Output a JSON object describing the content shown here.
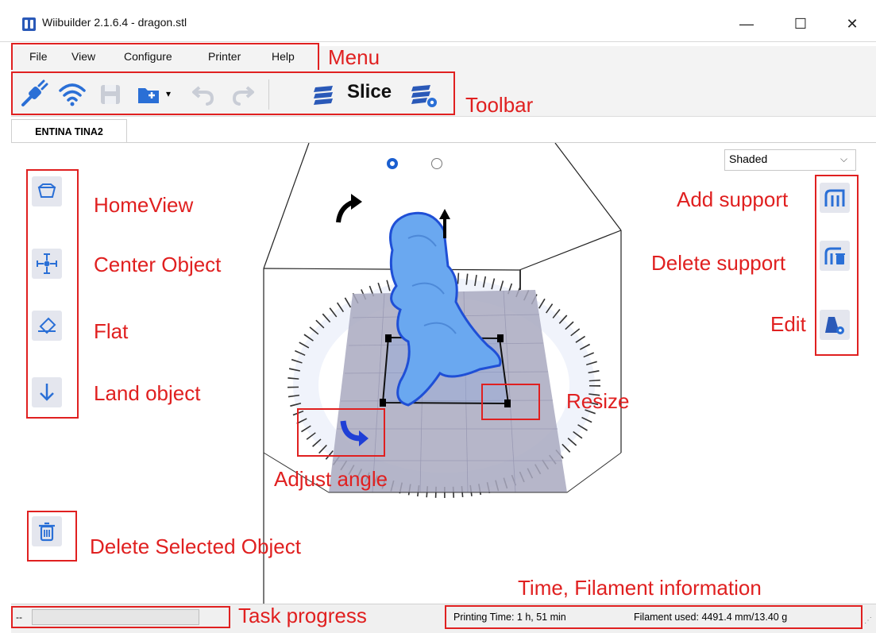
{
  "window": {
    "title": "Wiibuilder 2.1.6.4 - dragon.stl",
    "minimize_glyph": "—",
    "maximize_glyph": "☐",
    "close_glyph": "✕"
  },
  "menu": {
    "items": [
      {
        "label": "File"
      },
      {
        "label": "View"
      },
      {
        "label": "Configure"
      },
      {
        "label": "Printer"
      },
      {
        "label": "Help"
      }
    ]
  },
  "toolbar": {
    "slice_label": "Slice"
  },
  "tabs": [
    {
      "label": "ENTINA TINA2"
    }
  ],
  "viewport": {
    "render_mode": "Shaded",
    "left_tools": [
      {
        "icon": "home-view-icon"
      },
      {
        "icon": "center-object-icon"
      },
      {
        "icon": "flat-icon"
      },
      {
        "icon": "land-object-icon"
      }
    ],
    "right_tools": [
      {
        "icon": "add-support-icon"
      },
      {
        "icon": "delete-support-icon"
      },
      {
        "icon": "edit-icon"
      }
    ],
    "delete_tool_icon": "trash-icon"
  },
  "annotations": {
    "menu": "Menu",
    "toolbar": "Toolbar",
    "home_view": "HomeView",
    "center_object": "Center Object",
    "flat": "Flat",
    "land_object": "Land object",
    "add_support": "Add support",
    "delete_support": "Delete support",
    "edit": "Edit",
    "resize": "Resize",
    "adjust_angle": "Adjust angle",
    "delete_selected": "Delete Selected Object",
    "time_filament": "Time,  Filament information",
    "task_progress": "Task progress"
  },
  "status": {
    "progress_text": "--",
    "progress_value": 0,
    "printing_time": "Printing Time:  1 h, 51 min",
    "filament_used": "Filament used:  4491.4 mm/13.40 g"
  },
  "colors": {
    "annotation_red": "#e02020",
    "model_blue": "#6aa8f0",
    "icon_blue": "#2a6fd6"
  }
}
